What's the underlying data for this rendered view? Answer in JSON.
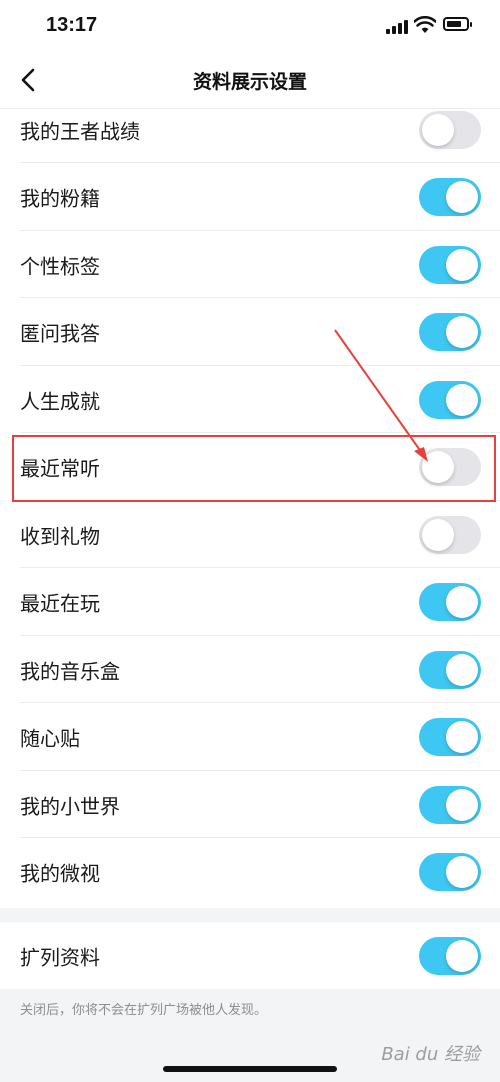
{
  "status": {
    "time": "13:17"
  },
  "nav": {
    "title": "资料展示设置",
    "back_icon": "chevron-left-icon"
  },
  "colors": {
    "toggle_on": "#3ec7f2",
    "toggle_off": "#e4e4e9",
    "annotation": "#e8403d"
  },
  "settings": [
    {
      "label": "我的王者战绩",
      "enabled": false
    },
    {
      "label": "我的粉籍",
      "enabled": true
    },
    {
      "label": "个性标签",
      "enabled": true
    },
    {
      "label": "匿问我答",
      "enabled": true
    },
    {
      "label": "人生成就",
      "enabled": true
    },
    {
      "label": "最近常听",
      "enabled": false
    },
    {
      "label": "收到礼物",
      "enabled": false
    },
    {
      "label": "最近在玩",
      "enabled": true
    },
    {
      "label": "我的音乐盒",
      "enabled": true
    },
    {
      "label": "随心贴",
      "enabled": true
    },
    {
      "label": "我的小世界",
      "enabled": true
    },
    {
      "label": "我的微视",
      "enabled": true
    }
  ],
  "extra_section": {
    "label": "扩列资料",
    "enabled": true
  },
  "footer_note": "关闭后，你将不会在扩列广场被他人发现。",
  "watermark": "Bai du 经验"
}
